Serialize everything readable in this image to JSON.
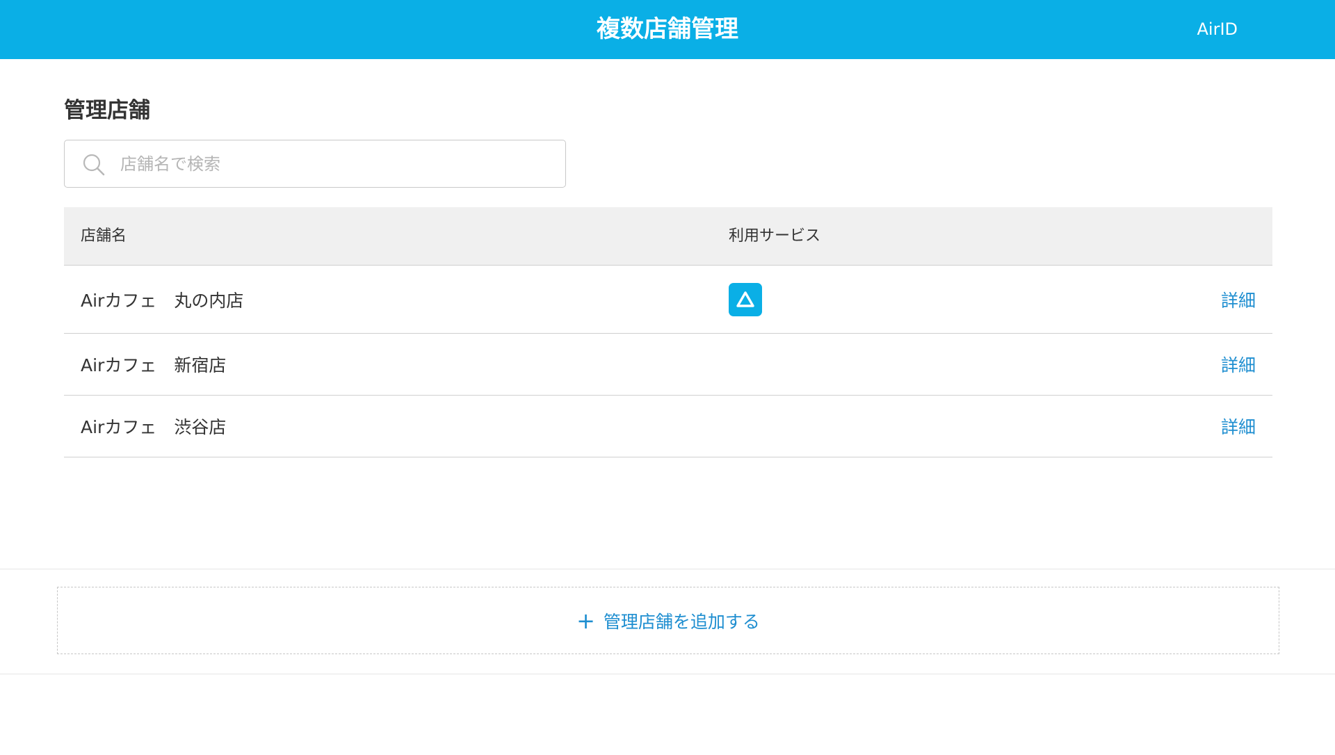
{
  "header": {
    "title": "複数店舗管理",
    "account_link": "AirID",
    "bg_color": "#0aafe6"
  },
  "section": {
    "title": "管理店舗"
  },
  "search": {
    "placeholder": "店舗名で検索",
    "value": "",
    "icon": "search-icon"
  },
  "table": {
    "columns": [
      "店舗名",
      "利用サービス"
    ],
    "rows": [
      {
        "name": "Airカフェ　丸の内店",
        "services": [
          "airregi-app-icon"
        ],
        "detail_label": "詳細"
      },
      {
        "name": "Airカフェ　新宿店",
        "services": [],
        "detail_label": "詳細"
      },
      {
        "name": "Airカフェ　渋谷店",
        "services": [],
        "detail_label": "詳細"
      }
    ]
  },
  "add_store": {
    "icon": "plus-icon",
    "plus": "+",
    "label": "管理店舗を追加する",
    "color": "#1e8ed0"
  }
}
